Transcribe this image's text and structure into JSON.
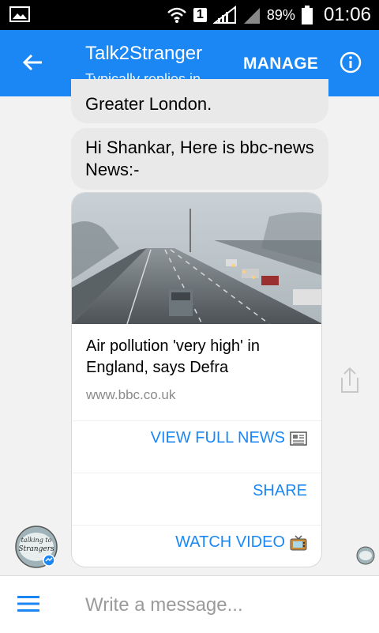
{
  "status_bar": {
    "sim_slot": "1",
    "battery": "89%",
    "time": "01:06"
  },
  "header": {
    "title": "Talk2Stranger",
    "subtitle": "Typically replies in...",
    "manage_label": "MANAGE"
  },
  "messages": [
    {
      "text": "Greater London."
    },
    {
      "text": "Hi Shankar, Here is bbc-news News:-"
    }
  ],
  "news_card": {
    "headline": "Air pollution 'very high' in England, says Defra",
    "source": "www.bbc.co.uk",
    "actions": [
      {
        "label": "VIEW FULL NEWS",
        "icon": "newspaper-icon"
      },
      {
        "label": "SHARE",
        "icon": ""
      },
      {
        "label": "WATCH VIDEO",
        "icon": "tv-icon"
      }
    ]
  },
  "avatar": {
    "text_line1": "talking to",
    "text_line2": "Strangers"
  },
  "composer": {
    "placeholder": "Write a message..."
  },
  "colors": {
    "accent": "#1b87f5",
    "bubble": "#e9e9e9",
    "status_bar": "#000000"
  }
}
